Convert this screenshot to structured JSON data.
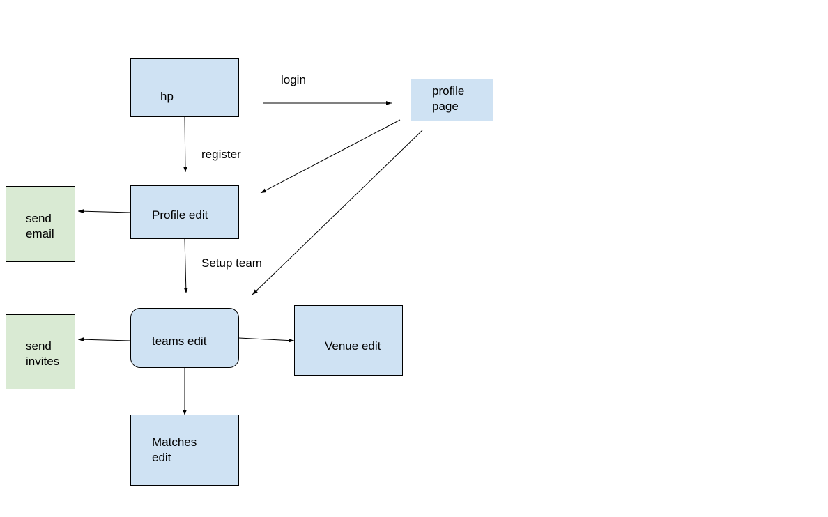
{
  "colors": {
    "page_node": "#cfe2f3",
    "action_node": "#d9ead3",
    "edge": "#000000"
  },
  "nodes": {
    "hp": "hp",
    "profile_page": "profile\npage",
    "profile_edit": "Profile edit",
    "send_email": "send\nemail",
    "teams_edit": "teams edit",
    "send_invites": "send\ninvites",
    "venue_edit": "Venue edit",
    "matches_edit": "Matches\nedit"
  },
  "edges": {
    "login": "login",
    "register": "register",
    "setup_team": "Setup team"
  }
}
